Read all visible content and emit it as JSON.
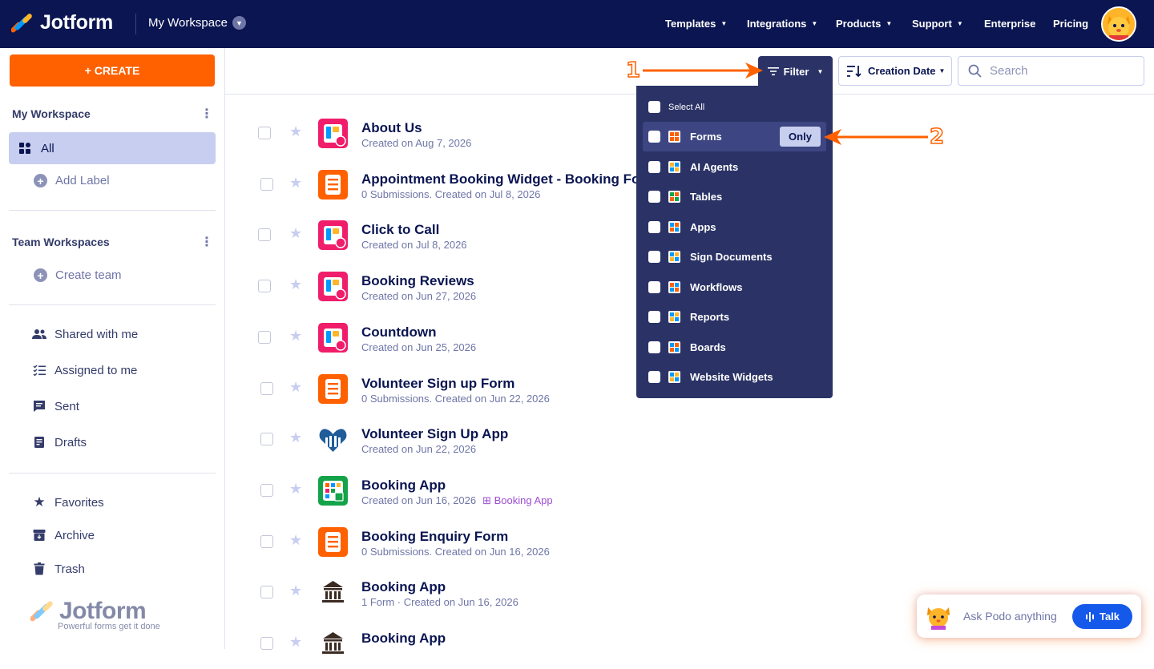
{
  "header": {
    "logo_text": "Jotform",
    "workspace": "My Workspace",
    "nav": [
      "Templates",
      "Integrations",
      "Products",
      "Support",
      "Enterprise",
      "Pricing"
    ]
  },
  "sidebar": {
    "create_label": "+ CREATE",
    "my_workspace_title": "My Workspace",
    "all_label": "All",
    "add_label": "Add Label",
    "team_title": "Team Workspaces",
    "create_team": "Create team",
    "items": [
      "Shared with me",
      "Assigned to me",
      "Sent",
      "Drafts"
    ],
    "bottom_items": [
      "Favorites",
      "Archive",
      "Trash"
    ],
    "footer_logo": "Jotform",
    "footer_tagline": "Powerful forms get it done"
  },
  "toolbar": {
    "filter_label": "Filter",
    "sort_label": "Creation Date",
    "search_placeholder": "Search"
  },
  "filter_menu": {
    "select_all": "Select All",
    "only_label": "Only",
    "items": [
      "Forms",
      "AI Agents",
      "Tables",
      "Apps",
      "Sign Documents",
      "Workflows",
      "Reports",
      "Boards",
      "Website Widgets"
    ]
  },
  "list": [
    {
      "title": "About Us",
      "subtitle": "Created on Aug 7, 2026",
      "icon": "app-icon",
      "tag": ""
    },
    {
      "title": "Appointment Booking Widget - Booking Form",
      "subtitle": "0 Submissions. Created on Jul 8, 2026",
      "icon": "form-icon",
      "tag": ""
    },
    {
      "title": "Click to Call",
      "subtitle": "Created on Jul 8, 2026",
      "icon": "app-icon",
      "tag": ""
    },
    {
      "title": "Booking Reviews",
      "subtitle": "Created on Jun 27, 2026",
      "icon": "app-icon",
      "tag": ""
    },
    {
      "title": "Countdown",
      "subtitle": "Created on Jun 25, 2026",
      "icon": "app-icon",
      "tag": ""
    },
    {
      "title": "Volunteer Sign up Form",
      "subtitle": "0 Submissions. Created on Jun 22, 2026",
      "icon": "form-icon",
      "tag": ""
    },
    {
      "title": "Volunteer Sign Up App",
      "subtitle": "Created on Jun 22, 2026",
      "icon": "hands-heart-icon",
      "tag": ""
    },
    {
      "title": "Booking App",
      "subtitle": "Created on Jun 16, 2026",
      "icon": "table-app-icon",
      "tag": "Booking App"
    },
    {
      "title": "Booking Enquiry Form",
      "subtitle": "0 Submissions. Created on Jun 16, 2026",
      "icon": "form-icon",
      "tag": ""
    },
    {
      "title": "Booking App",
      "subtitle": "1 Form · Created on Jun 16, 2026",
      "icon": "building-icon",
      "tag": ""
    },
    {
      "title": "Booking App",
      "subtitle": "",
      "icon": "building-icon",
      "tag": ""
    }
  ],
  "podo": {
    "prompt": "Ask Podo anything",
    "talk_label": "Talk"
  },
  "annotations": {
    "one": "1",
    "two": "2"
  },
  "colors": {
    "topbar": "#0a1551",
    "create": "#ff6100",
    "menu": "#2b3366",
    "talk": "#1559ea",
    "annotation": "#ff6100"
  }
}
